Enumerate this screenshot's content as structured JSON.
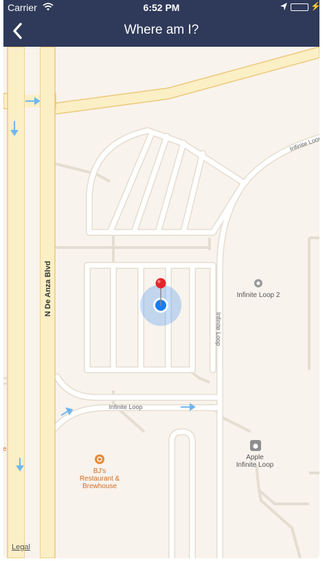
{
  "status_bar": {
    "carrier": "Carrier",
    "time": "6:52 PM",
    "battery_level": 1.0,
    "wifi_icon": "wifi-icon",
    "location_icon": "location-arrow-icon"
  },
  "nav": {
    "title": "Where am I?",
    "back_icon": "chevron-left-icon",
    "bar_color": "#2f3a5a"
  },
  "map": {
    "road_labels": {
      "de_anza": "N De Anza Blvd",
      "loop_top": "Infinite Loop",
      "loop_vertical": "Infinite Loop",
      "loop_bottom": "Infinite Loop"
    },
    "pois": {
      "il2": "Infinite Loop 2",
      "apple_line1": "Apple",
      "apple_line2": "Infinite Loop",
      "bjs_line1": "BJ's",
      "bjs_line2": "Restaurant &",
      "bjs_line3": "Brewhouse"
    },
    "edge_letter": "e",
    "legal": "Legal",
    "colors": {
      "highway": "#fbefc6",
      "highway_edge": "#edc87a",
      "user_dot": "#1a7cf0",
      "pin": "#e5262b",
      "poi_orange": "#e58b3a"
    }
  }
}
